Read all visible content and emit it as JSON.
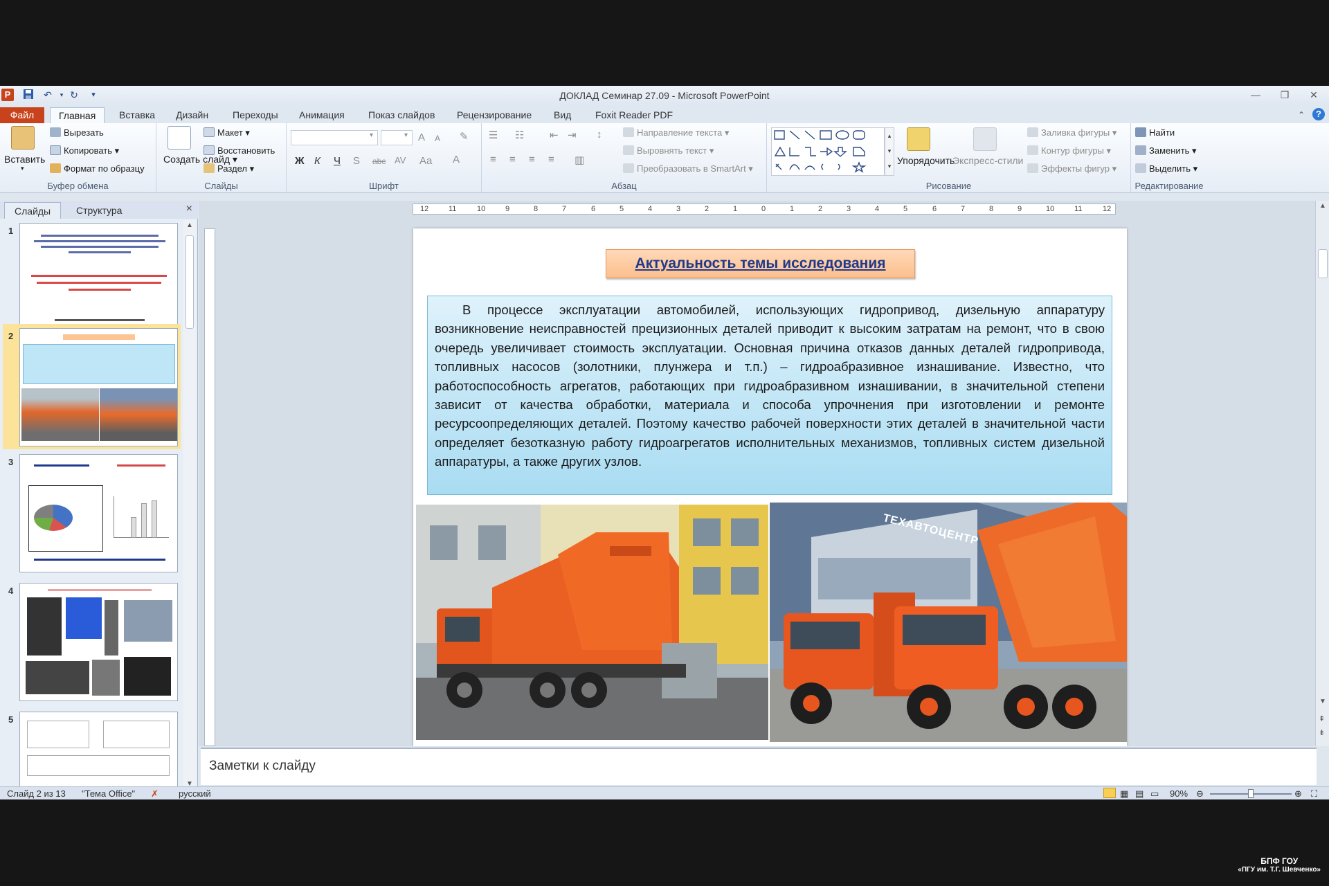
{
  "window": {
    "title": "ДОКЛАД Семинар 27.09 - Microsoft PowerPoint",
    "app_icon": "P"
  },
  "tabs": {
    "file": "Файл",
    "items": [
      "Главная",
      "Вставка",
      "Дизайн",
      "Переходы",
      "Анимация",
      "Показ слайдов",
      "Рецензирование",
      "Вид",
      "Foxit Reader PDF"
    ],
    "active": "Главная"
  },
  "ribbon": {
    "clipboard": {
      "label": "Буфер обмена",
      "paste": "Вставить",
      "cut": "Вырезать",
      "copy": "Копировать",
      "format_painter": "Формат по образцу"
    },
    "slides": {
      "label": "Слайды",
      "new_slide": "Создать слайд",
      "layout": "Макет",
      "reset": "Восстановить",
      "section": "Раздел"
    },
    "font": {
      "label": "Шрифт",
      "bold": "Ж",
      "italic": "К",
      "underline": "Ч",
      "strike": "S",
      "strike2": "abc",
      "spacing": "AV",
      "case": "Aa",
      "grow": "A",
      "shrink": "A",
      "color": "A"
    },
    "paragraph": {
      "label": "Абзац",
      "text_direction": "Направление текста",
      "align_text": "Выровнять текст",
      "smartart": "Преобразовать в SmartArt"
    },
    "drawing": {
      "label": "Рисование",
      "arrange": "Упорядочить",
      "quick_styles": "Экспресс-стили",
      "fill": "Заливка фигуры",
      "outline": "Контур фигуры",
      "effects": "Эффекты фигур"
    },
    "editing": {
      "label": "Редактирование",
      "find": "Найти",
      "replace": "Заменить",
      "select": "Выделить"
    }
  },
  "panel": {
    "tab_slides": "Слайды",
    "tab_outline": "Структура",
    "close": "×",
    "thumb_numbers": [
      "1",
      "2",
      "3",
      "4",
      "5"
    ]
  },
  "ruler": {
    "labels": [
      "12",
      "11",
      "10",
      "9",
      "8",
      "7",
      "6",
      "5",
      "4",
      "3",
      "2",
      "1",
      "0",
      "1",
      "2",
      "3",
      "4",
      "5",
      "6",
      "7",
      "8",
      "9",
      "10",
      "11",
      "12"
    ]
  },
  "slide": {
    "title": "Актуальность темы исследования",
    "body": "В процессе эксплуатации автомобилей, использующих гидропривод, дизельную аппаратуру возникновение неисправностей прецизионных деталей приводит к высоким затратам на ремонт, что в свою очередь увеличивает стоимость эксплуатации. Основная причина отказов данных деталей гидропривода, топливных насосов (золотники, плунжера и т.п.) – гидроабразивное изнашивание. Известно, что работоспособность агрегатов, работающих при гидроабразивном изнашивании, в значительной степени зависит от качества обработки, материала и способа упрочнения при изготовлении и ремонте ресурсоопределяющих деталей. Поэтому качество рабочей поверхности этих деталей в значительной части определяет безотказную работу гидроагрегатов исполнительных механизмов, топливных систем дизельной аппаратуры, а также других узлов.",
    "photo2_sign": "ТЕХАВТОЦЕНТР"
  },
  "notes": {
    "placeholder": "Заметки к слайду"
  },
  "status": {
    "slide_info": "Слайд 2 из 13",
    "theme": "\"Тема Office\"",
    "language": "русский",
    "zoom": "90%",
    "zoom_fraction": 0.5
  },
  "watermark": {
    "line1": "БПФ ГОУ",
    "line2": "«ПГУ им. Т.Г. Шевченко»"
  }
}
